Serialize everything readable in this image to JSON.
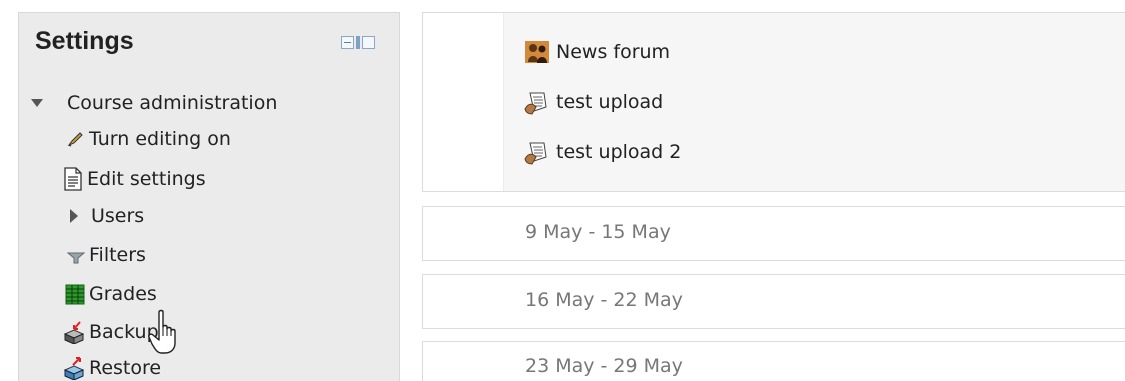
{
  "settings": {
    "title": "Settings",
    "tree": {
      "root_label": "Course administration",
      "items": [
        {
          "label": "Turn editing on",
          "icon": "pencil-icon"
        },
        {
          "label": "Edit settings",
          "icon": "document-icon"
        },
        {
          "label": "Users",
          "icon": "chevron-right-icon"
        },
        {
          "label": "Filters",
          "icon": "funnel-icon"
        },
        {
          "label": "Grades",
          "icon": "grades-table-icon"
        },
        {
          "label": "Backup",
          "icon": "backup-icon"
        },
        {
          "label": "Restore",
          "icon": "restore-icon"
        }
      ]
    }
  },
  "course": {
    "activities": [
      {
        "label": "News forum",
        "icon": "forum-icon"
      },
      {
        "label": "test upload",
        "icon": "assignment-icon"
      },
      {
        "label": "test upload 2",
        "icon": "assignment-icon"
      }
    ],
    "weeks": [
      {
        "title": "9 May - 15 May"
      },
      {
        "title": "16 May - 22 May"
      },
      {
        "title": "23 May - 29 May"
      }
    ]
  }
}
